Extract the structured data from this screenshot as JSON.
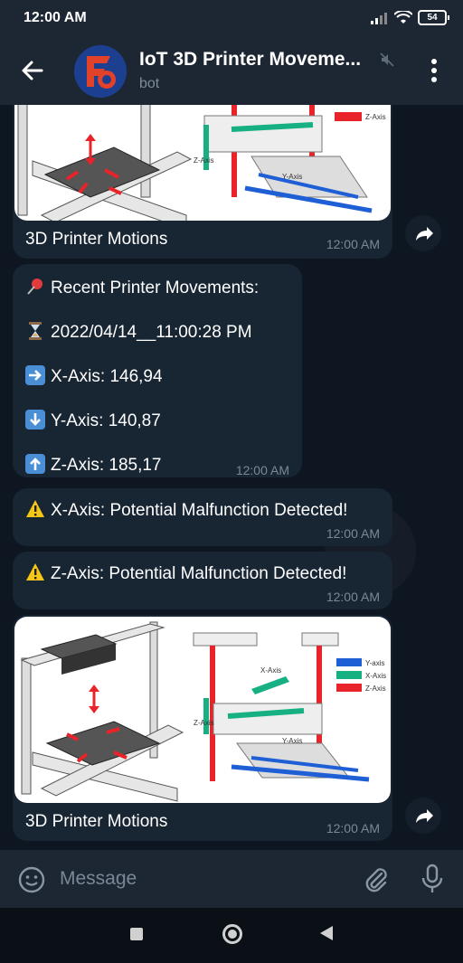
{
  "status": {
    "time": "12:00 AM",
    "battery": "54"
  },
  "header": {
    "title": "IoT 3D Printer Moveme...",
    "subtitle": "bot"
  },
  "messages": {
    "photo1": {
      "caption": "3D Printer Motions",
      "time": "12:00 AM"
    },
    "movements": {
      "title": "Recent Printer Movements:",
      "timestamp": "2022/04/14__11:00:28 PM",
      "x_axis": "X-Axis: 146,94",
      "y_axis": "Y-Axis: 140,87",
      "z_axis": "Z-Axis: 185,17",
      "time": "12:00 AM"
    },
    "alert_x": {
      "text": "X-Axis: Potential Malfunction Detected!",
      "time": "12:00 AM"
    },
    "alert_z": {
      "text": "Z-Axis: Potential Malfunction Detected!",
      "time": "12:00 AM"
    },
    "photo2": {
      "caption": "3D Printer Motions",
      "time": "12:00 AM"
    }
  },
  "diagram": {
    "legend": [
      "Y-axis",
      "X-Axis",
      "Z-Axis"
    ],
    "label_x": "X-Axis",
    "label_y": "Y-Axis",
    "label_z": "Z-Axis",
    "colors": {
      "y": "#1f5fd6",
      "x": "#16b083",
      "z": "#e8242a"
    }
  },
  "input": {
    "placeholder": "Message"
  }
}
